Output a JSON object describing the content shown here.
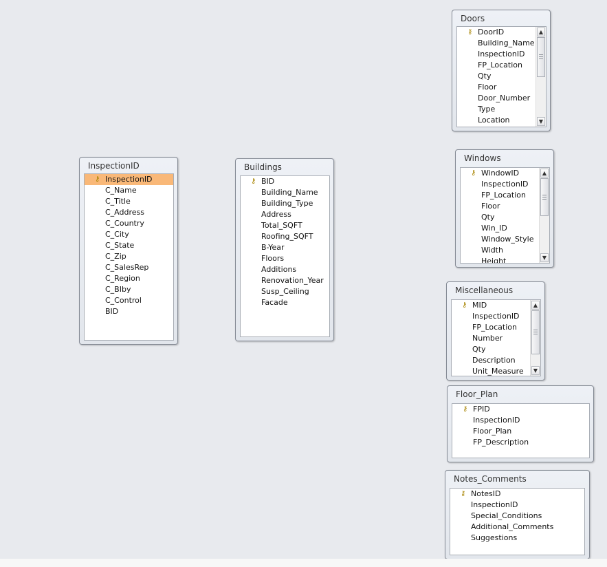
{
  "tables": {
    "inspection": {
      "title": "InspectionID",
      "fields": [
        "InspectionID",
        "C_Name",
        "C_Title",
        "C_Address",
        "C_Country",
        "C_City",
        "C_State",
        "C_Zip",
        "C_SalesRep",
        "C_Region",
        "C_BIby",
        "C_Control",
        "BID"
      ]
    },
    "buildings": {
      "title": "Buildings",
      "fields": [
        "BID",
        "Building_Name",
        "Building_Type",
        "Address",
        "Total_SQFT",
        "Roofing_SQFT",
        "B-Year",
        "Floors",
        "Additions",
        "Renovation_Year",
        "Susp_Ceiling",
        "Facade"
      ]
    },
    "doors": {
      "title": "Doors",
      "fields": [
        "DoorID",
        "Building_Name",
        "InspectionID",
        "FP_Location",
        "Qty",
        "Floor",
        "Door_Number",
        "Type",
        "Location"
      ]
    },
    "windows": {
      "title": "Windows",
      "fields": [
        "WindowID",
        "InspectionID",
        "FP_Location",
        "Floor",
        "Qty",
        "Win_ID",
        "Window_Style",
        "Width",
        "Height"
      ]
    },
    "misc": {
      "title": "Miscellaneous",
      "fields": [
        "MID",
        "InspectionID",
        "FP_Location",
        "Number",
        "Qty",
        "Description",
        "Unit_Measure"
      ]
    },
    "floor_plan": {
      "title": "Floor_Plan",
      "fields": [
        "FPID",
        "InspectionID",
        "Floor_Plan",
        "FP_Description"
      ]
    },
    "notes": {
      "title": "Notes_Comments",
      "fields": [
        "NotesID",
        "InspectionID",
        "Special_Conditions",
        "Additional_Comments",
        "Suggestions"
      ]
    }
  },
  "icons": {
    "primary_key": "key-icon",
    "scroll_up": "arrow-up-icon",
    "scroll_down": "arrow-down-icon"
  },
  "colors": {
    "canvas": "#e8eaee",
    "selected_row": "#f9b878"
  }
}
